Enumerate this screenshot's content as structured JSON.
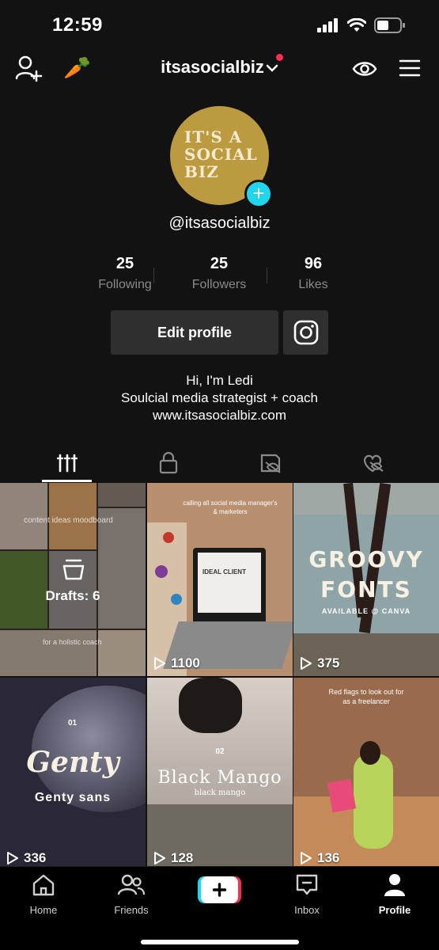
{
  "status": {
    "time": "12:59"
  },
  "nav": {
    "username": "itsasocialbiz"
  },
  "profile": {
    "avatar_text": "IT'S A\nSOCIAL\nBIZ",
    "handle": "@itsasocialbiz",
    "edit_label": "Edit profile",
    "bio": [
      "Hi, I'm Ledi",
      "Soulcial media strategist + coach",
      "www.itsasocialbiz.com"
    ]
  },
  "stats": [
    {
      "value": "25",
      "label": "Following"
    },
    {
      "value": "25",
      "label": "Followers"
    },
    {
      "value": "96",
      "label": "Likes"
    }
  ],
  "grid": {
    "drafts_label": "Drafts: 6",
    "draft_texts": [
      "content ideas moodboard",
      "for a holistic coach"
    ],
    "videos": [
      {
        "views": "1100",
        "caption": "calling all social media manager's & marketers",
        "extra": "IDEAL CLIENT"
      },
      {
        "views": "375",
        "title": "GROOVY FONTS",
        "sub": "AVAILABLE @ CANVA"
      },
      {
        "views": "336",
        "number": "01",
        "title": "Genty",
        "sub": "Genty sans"
      },
      {
        "views": "128",
        "number": "02",
        "title": "Black Mango",
        "sub": "black mango"
      },
      {
        "views": "136",
        "title": "Red flags to look out for as a freelancer"
      }
    ]
  },
  "bottom_nav": {
    "home": "Home",
    "friends": "Friends",
    "inbox": "Inbox",
    "profile": "Profile"
  },
  "colors": {
    "background": "#121212",
    "accent": "#fe2c55",
    "avatar": "#bc9a3f",
    "add_badge": "#20d5ec"
  }
}
